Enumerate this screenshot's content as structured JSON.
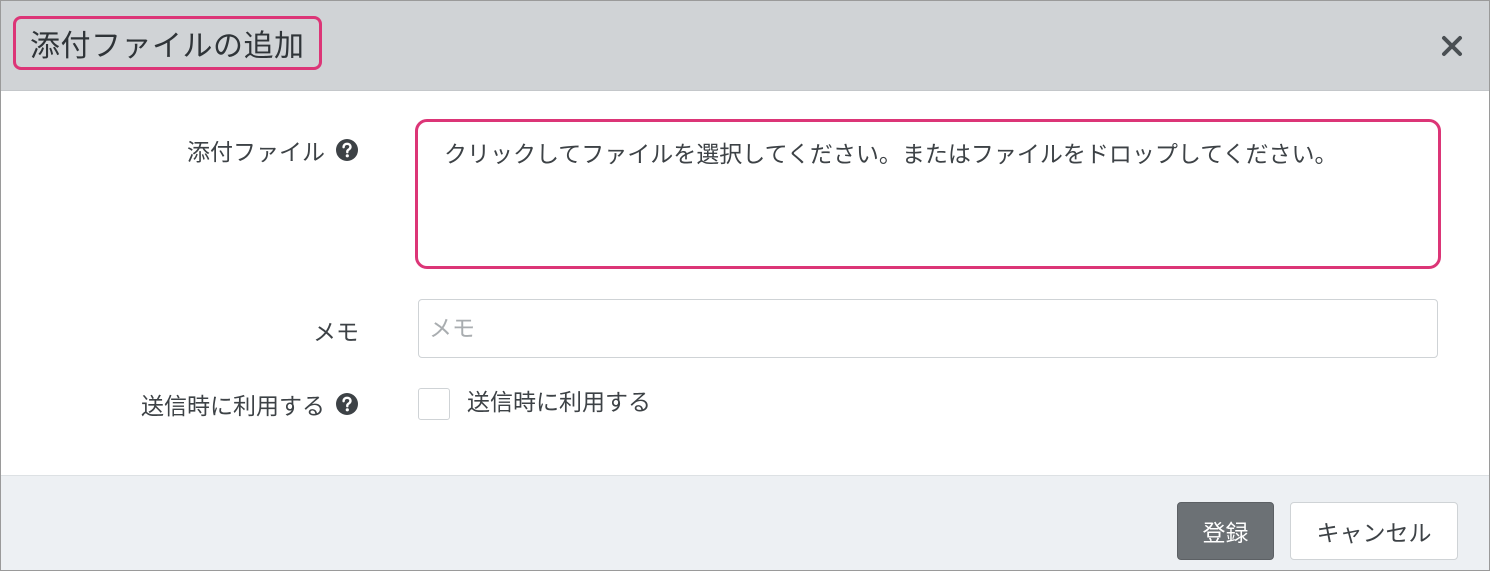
{
  "dialog": {
    "title": "添付ファイルの追加",
    "close_icon": "close-icon"
  },
  "form": {
    "attachment": {
      "label": "添付ファイル",
      "help_icon": "question-circle-icon",
      "drop_text": "クリックしてファイルを選択してください。またはファイルをドロップしてください。"
    },
    "memo": {
      "label": "メモ",
      "placeholder": "メモ",
      "value": ""
    },
    "use_on_send": {
      "label": "送信時に利用する",
      "help_icon": "question-circle-icon",
      "checkbox_label": "送信時に利用する",
      "checked": false
    }
  },
  "footer": {
    "register_label": "登録",
    "cancel_label": "キャンセル"
  },
  "colors": {
    "highlight": "#dc3577",
    "header_bg": "#d0d3d6",
    "footer_bg": "#edf0f3",
    "primary_button": "#6c7175"
  }
}
